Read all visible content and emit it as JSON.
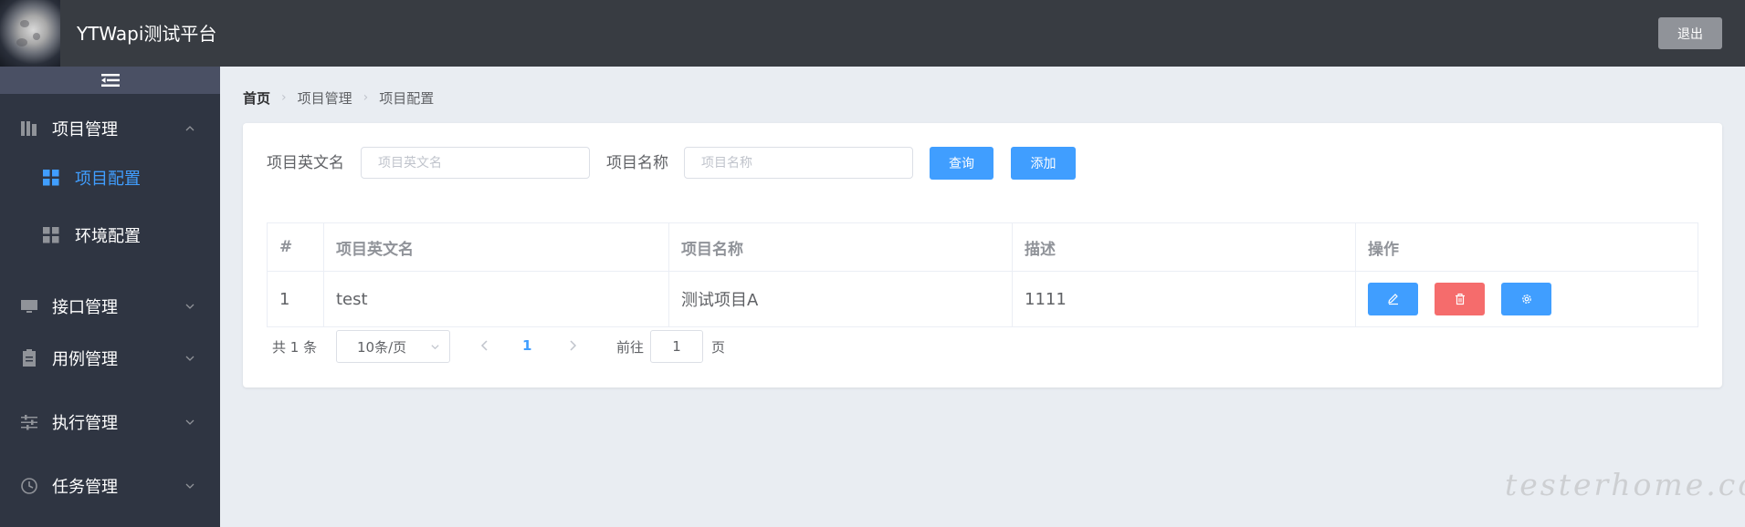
{
  "header": {
    "app_title": "YTWapi测试平台",
    "logout_label": "退出"
  },
  "sidebar": {
    "menus": [
      {
        "label": "项目管理",
        "icon": "book-icon",
        "expanded": true,
        "children": [
          {
            "label": "项目配置",
            "icon": "grid-icon",
            "active": true
          },
          {
            "label": "环境配置",
            "icon": "grid-icon",
            "active": false
          }
        ]
      },
      {
        "label": "接口管理",
        "icon": "monitor-icon",
        "expanded": false
      },
      {
        "label": "用例管理",
        "icon": "clipboard-icon",
        "expanded": false
      },
      {
        "label": "执行管理",
        "icon": "sliders-icon",
        "expanded": false
      },
      {
        "label": "任务管理",
        "icon": "clock-icon",
        "expanded": false
      }
    ]
  },
  "breadcrumb": [
    "首页",
    "项目管理",
    "项目配置"
  ],
  "search": {
    "en_name_label": "项目英文名",
    "en_name_placeholder": "项目英文名",
    "en_name_value": "",
    "name_label": "项目名称",
    "name_placeholder": "项目名称",
    "name_value": "",
    "query_label": "查询",
    "add_label": "添加"
  },
  "table": {
    "columns": [
      "#",
      "项目英文名",
      "项目名称",
      "描述",
      "操作"
    ],
    "rows": [
      {
        "index": "1",
        "en_name": "test",
        "name": "测试项目A",
        "description": "1111"
      }
    ]
  },
  "pagination": {
    "total_text": "共 1 条",
    "page_size": "10条/页",
    "current_page": "1",
    "goto_label": "前往",
    "goto_value": "1",
    "page_unit": "页"
  },
  "watermark": "testerhome.com",
  "colors": {
    "header_bg": "#383c42",
    "sidebar_bg": "#2f3542",
    "primary": "#409eff",
    "danger": "#f56c6c",
    "logout_bg": "#909399",
    "page_bg": "#e9edf2"
  }
}
